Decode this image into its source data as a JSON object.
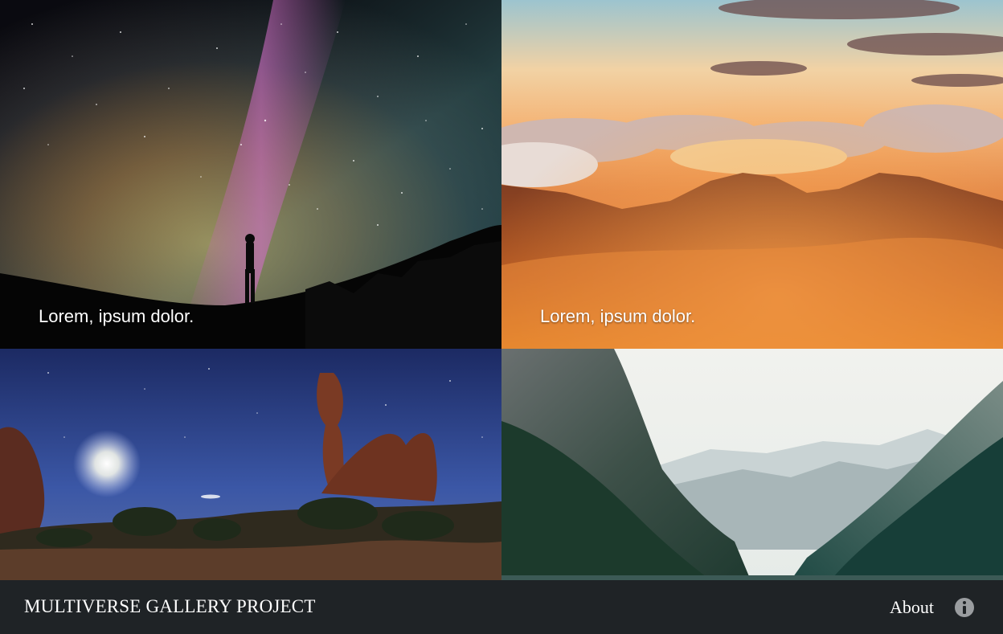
{
  "gallery": {
    "tiles": [
      {
        "caption": "Lorem, ipsum dolor.",
        "scene": "milky-way-silhouette"
      },
      {
        "caption": "Lorem, ipsum dolor.",
        "scene": "sunset-mountains-clouds"
      },
      {
        "caption": "",
        "scene": "desert-arch-moon-night"
      },
      {
        "caption": "",
        "scene": "alpine-lake-valley"
      }
    ]
  },
  "footer": {
    "brand": "MULTIVERSE GALLERY PROJECT",
    "about_label": "About",
    "info_icon": "info-icon"
  },
  "colors": {
    "footer_bg": "#1f2326",
    "text": "#ffffff",
    "icon": "#9a9da0"
  }
}
